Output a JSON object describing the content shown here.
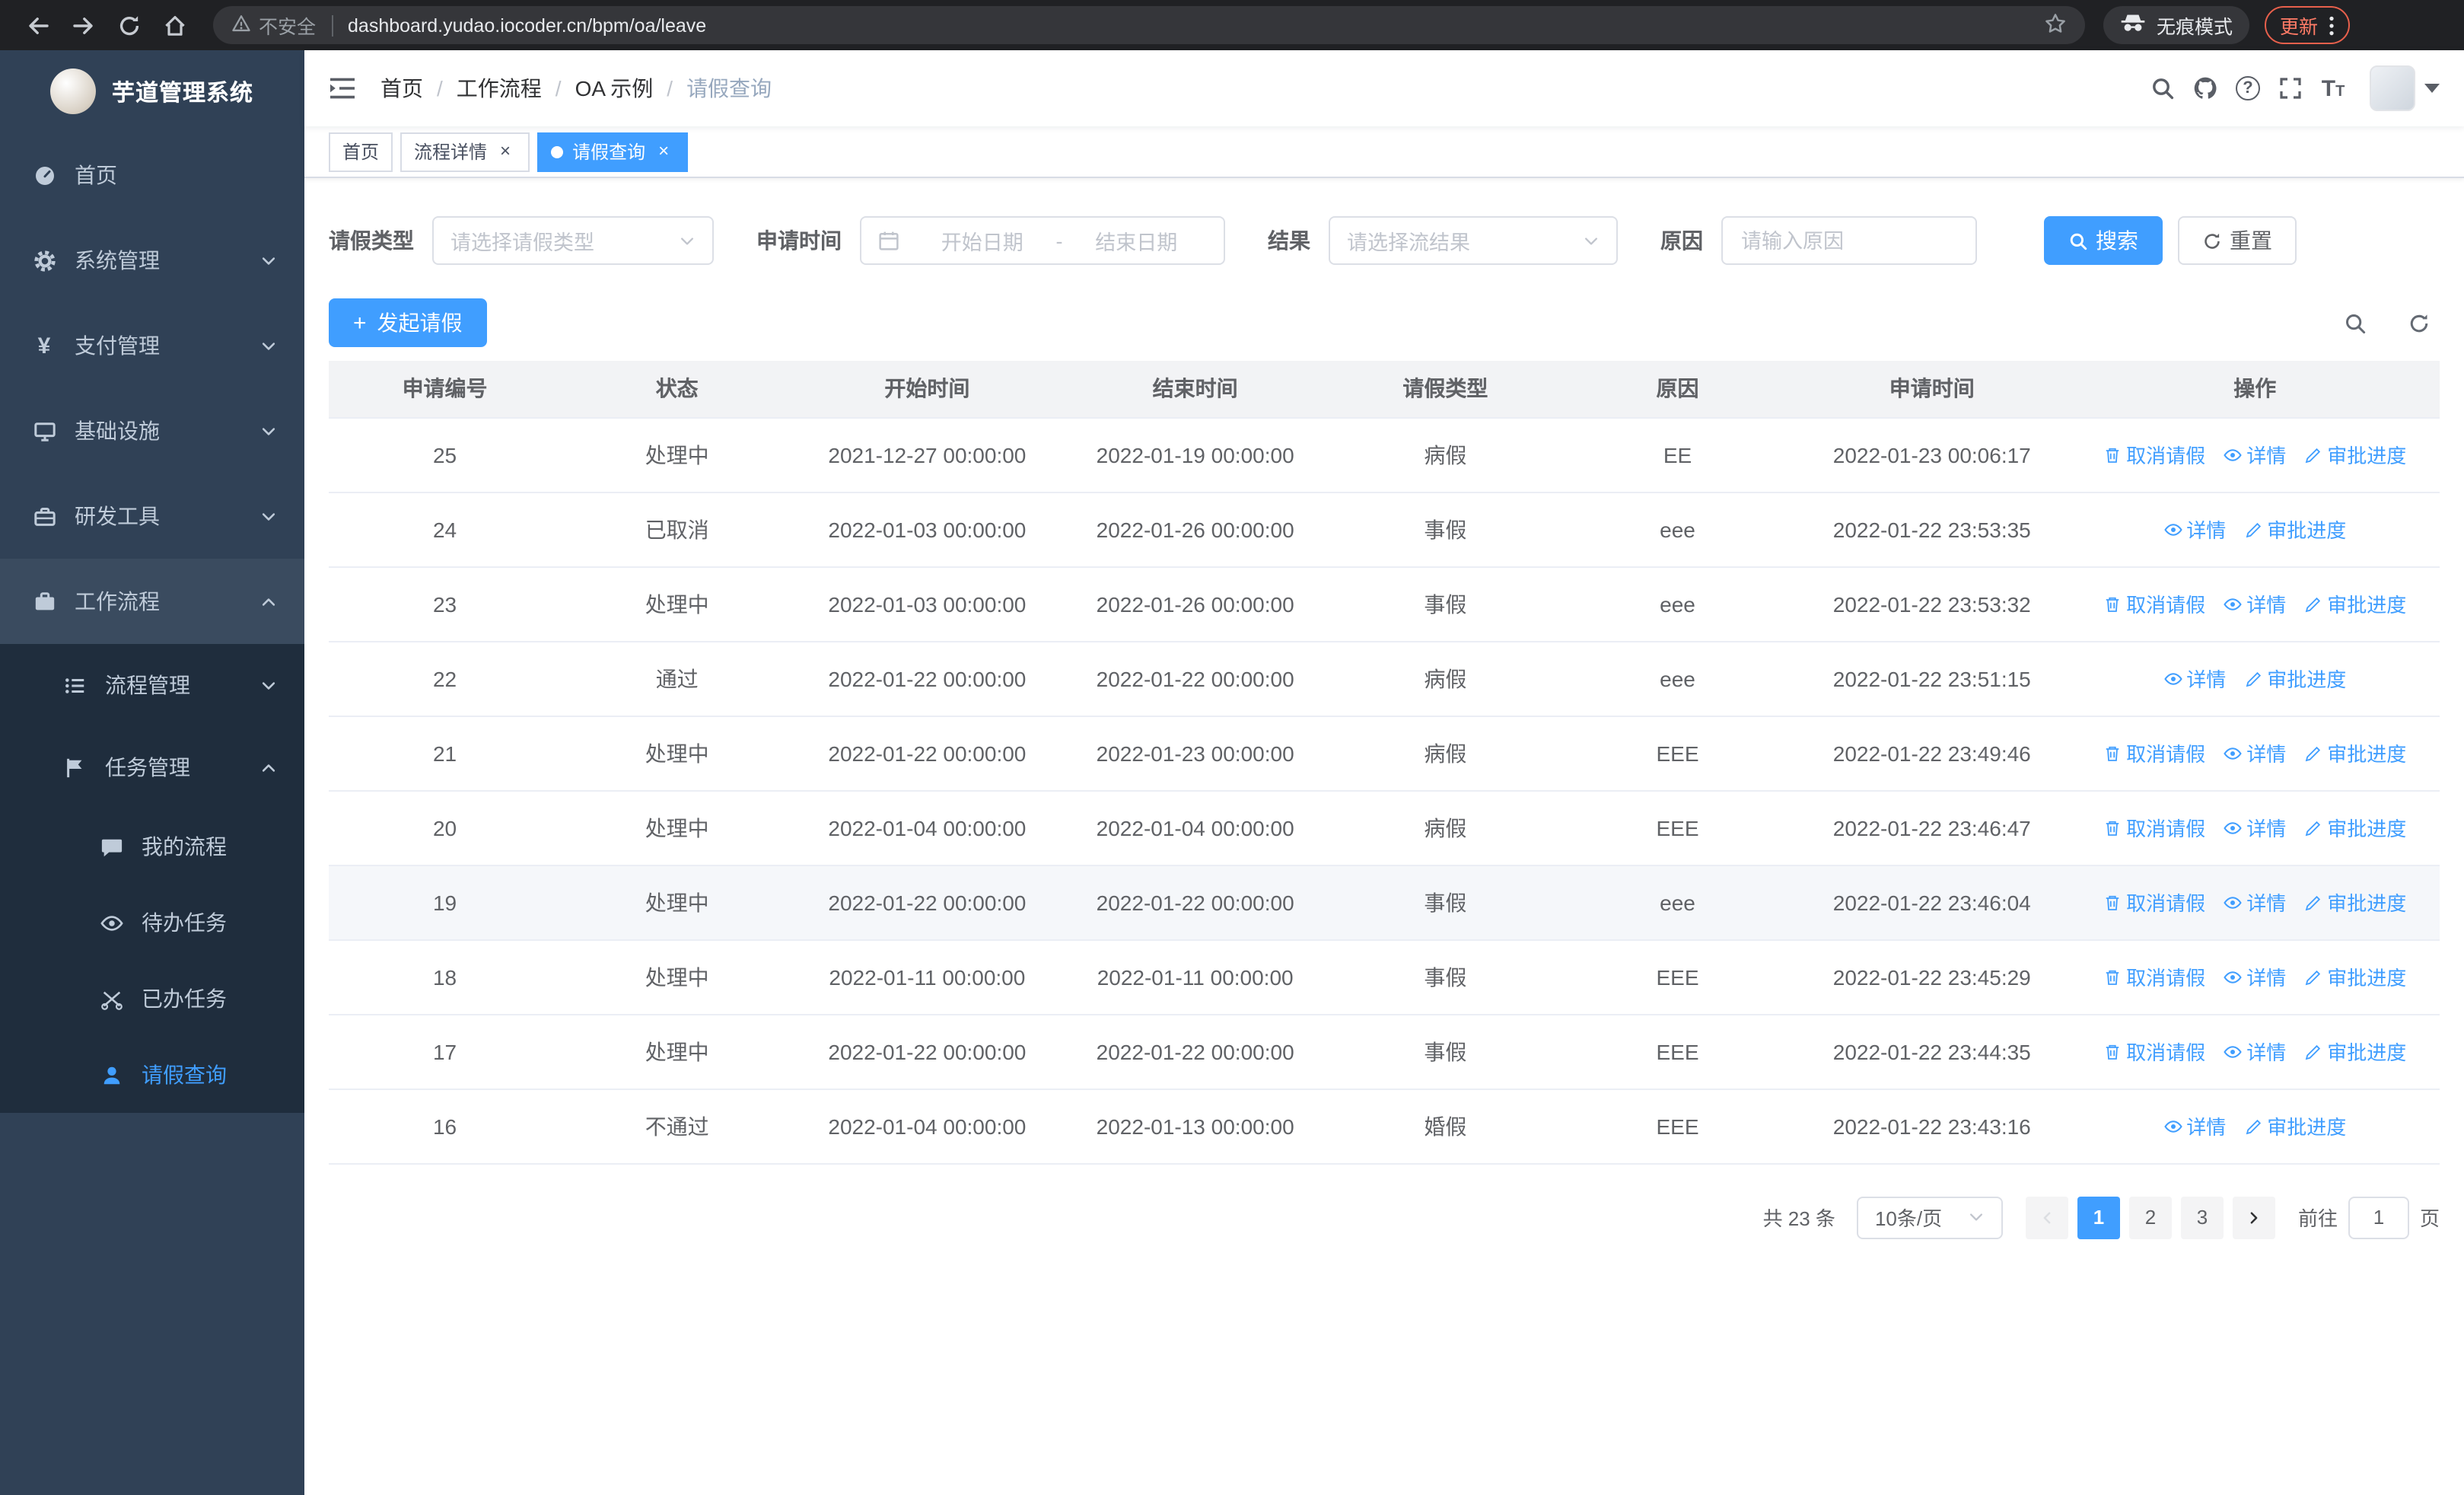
{
  "browser": {
    "security_warning": "不安全",
    "url": "dashboard.yudao.iocoder.cn/bpm/oa/leave",
    "incognito_label": "无痕模式",
    "update_label": "更新"
  },
  "sidebar": {
    "logo_title": "芋道管理系统",
    "items": [
      {
        "key": "home",
        "label": "首页",
        "icon": "dashboard-icon",
        "depth": 0,
        "arrow": null,
        "active": false,
        "highlight": false
      },
      {
        "key": "system-mgmt",
        "label": "系统管理",
        "icon": "gear-icon",
        "depth": 0,
        "arrow": "down",
        "active": false,
        "highlight": false
      },
      {
        "key": "payment-mgmt",
        "label": "支付管理",
        "icon": "yen-icon",
        "depth": 0,
        "arrow": "down",
        "active": false,
        "highlight": false
      },
      {
        "key": "infrastructure",
        "label": "基础设施",
        "icon": "monitor-icon",
        "depth": 0,
        "arrow": "down",
        "active": false,
        "highlight": false
      },
      {
        "key": "dev-tools",
        "label": "研发工具",
        "icon": "toolbox-icon",
        "depth": 0,
        "arrow": "down",
        "active": false,
        "highlight": false
      },
      {
        "key": "workflow",
        "label": "工作流程",
        "icon": "briefcase-icon",
        "depth": 0,
        "arrow": "up",
        "active": false,
        "highlight": true
      },
      {
        "key": "process-mgmt",
        "label": "流程管理",
        "icon": "list-icon",
        "depth": 1,
        "arrow": "down",
        "active": false,
        "highlight": false
      },
      {
        "key": "task-mgmt",
        "label": "任务管理",
        "icon": "flag-icon",
        "depth": 1,
        "arrow": "up",
        "active": false,
        "highlight": false
      },
      {
        "key": "my-process",
        "label": "我的流程",
        "icon": "message-icon",
        "depth": 2,
        "arrow": null,
        "active": false,
        "highlight": false
      },
      {
        "key": "todo-tasks",
        "label": "待办任务",
        "icon": "eye-icon",
        "depth": 2,
        "arrow": null,
        "active": false,
        "highlight": false
      },
      {
        "key": "done-tasks",
        "label": "已办任务",
        "icon": "scissors-icon",
        "depth": 2,
        "arrow": null,
        "active": false,
        "highlight": false
      },
      {
        "key": "leave-query",
        "label": "请假查询",
        "icon": "user-icon",
        "depth": 2,
        "arrow": null,
        "active": true,
        "highlight": false
      }
    ]
  },
  "header": {
    "breadcrumb": [
      "首页",
      "工作流程",
      "OA 示例",
      "请假查询"
    ]
  },
  "tabs": [
    {
      "label": "首页"
    },
    {
      "label": "流程详情"
    },
    {
      "label": "请假查询"
    }
  ],
  "filters": {
    "leave_type_label": "请假类型",
    "leave_type_placeholder": "请选择请假类型",
    "apply_time_label": "申请时间",
    "date_start_placeholder": "开始日期",
    "date_separator": "-",
    "date_end_placeholder": "结束日期",
    "result_label": "结果",
    "result_placeholder": "请选择流结果",
    "reason_label": "原因",
    "reason_placeholder": "请输入原因",
    "search_label": "搜索",
    "reset_label": "重置"
  },
  "toolbar": {
    "create_label": "发起请假"
  },
  "table": {
    "columns": [
      "申请编号",
      "状态",
      "开始时间",
      "结束时间",
      "请假类型",
      "原因",
      "申请时间",
      "操作"
    ],
    "action_labels": {
      "cancel": "取消请假",
      "detail": "详情",
      "progress": "审批进度"
    },
    "rows": [
      {
        "id": "25",
        "status": "处理中",
        "start": "2021-12-27 00:00:00",
        "end": "2022-01-19 00:00:00",
        "type": "病假",
        "reason": "EE",
        "apply_time": "2022-01-23 00:06:17",
        "actions": [
          "cancel",
          "detail",
          "progress"
        ],
        "highlight": false
      },
      {
        "id": "24",
        "status": "已取消",
        "start": "2022-01-03 00:00:00",
        "end": "2022-01-26 00:00:00",
        "type": "事假",
        "reason": "eee",
        "apply_time": "2022-01-22 23:53:35",
        "actions": [
          "detail",
          "progress"
        ],
        "highlight": false
      },
      {
        "id": "23",
        "status": "处理中",
        "start": "2022-01-03 00:00:00",
        "end": "2022-01-26 00:00:00",
        "type": "事假",
        "reason": "eee",
        "apply_time": "2022-01-22 23:53:32",
        "actions": [
          "cancel",
          "detail",
          "progress"
        ],
        "highlight": false
      },
      {
        "id": "22",
        "status": "通过",
        "start": "2022-01-22 00:00:00",
        "end": "2022-01-22 00:00:00",
        "type": "病假",
        "reason": "eee",
        "apply_time": "2022-01-22 23:51:15",
        "actions": [
          "detail",
          "progress"
        ],
        "highlight": false
      },
      {
        "id": "21",
        "status": "处理中",
        "start": "2022-01-22 00:00:00",
        "end": "2022-01-23 00:00:00",
        "type": "病假",
        "reason": "EEE",
        "apply_time": "2022-01-22 23:49:46",
        "actions": [
          "cancel",
          "detail",
          "progress"
        ],
        "highlight": false
      },
      {
        "id": "20",
        "status": "处理中",
        "start": "2022-01-04 00:00:00",
        "end": "2022-01-04 00:00:00",
        "type": "病假",
        "reason": "EEE",
        "apply_time": "2022-01-22 23:46:47",
        "actions": [
          "cancel",
          "detail",
          "progress"
        ],
        "highlight": false
      },
      {
        "id": "19",
        "status": "处理中",
        "start": "2022-01-22 00:00:00",
        "end": "2022-01-22 00:00:00",
        "type": "事假",
        "reason": "eee",
        "apply_time": "2022-01-22 23:46:04",
        "actions": [
          "cancel",
          "detail",
          "progress"
        ],
        "highlight": true
      },
      {
        "id": "18",
        "status": "处理中",
        "start": "2022-01-11 00:00:00",
        "end": "2022-01-11 00:00:00",
        "type": "事假",
        "reason": "EEE",
        "apply_time": "2022-01-22 23:45:29",
        "actions": [
          "cancel",
          "detail",
          "progress"
        ],
        "highlight": false
      },
      {
        "id": "17",
        "status": "处理中",
        "start": "2022-01-22 00:00:00",
        "end": "2022-01-22 00:00:00",
        "type": "事假",
        "reason": "EEE",
        "apply_time": "2022-01-22 23:44:35",
        "actions": [
          "cancel",
          "detail",
          "progress"
        ],
        "highlight": false
      },
      {
        "id": "16",
        "status": "不通过",
        "start": "2022-01-04 00:00:00",
        "end": "2022-01-13 00:00:00",
        "type": "婚假",
        "reason": "EEE",
        "apply_time": "2022-01-22 23:43:16",
        "actions": [
          "detail",
          "progress"
        ],
        "highlight": false
      }
    ]
  },
  "pagination": {
    "total_text": "共 23 条",
    "page_size": "10条/页",
    "pages": [
      "1",
      "2",
      "3"
    ],
    "active_page": "1",
    "goto_prefix": "前往",
    "goto_value": "1",
    "goto_suffix": "页"
  },
  "colors": {
    "accent": "#409eff",
    "sidebar_bg": "#304156",
    "submenu_bg": "#1f2d3d",
    "table_header_bg": "#f2f3f5"
  }
}
